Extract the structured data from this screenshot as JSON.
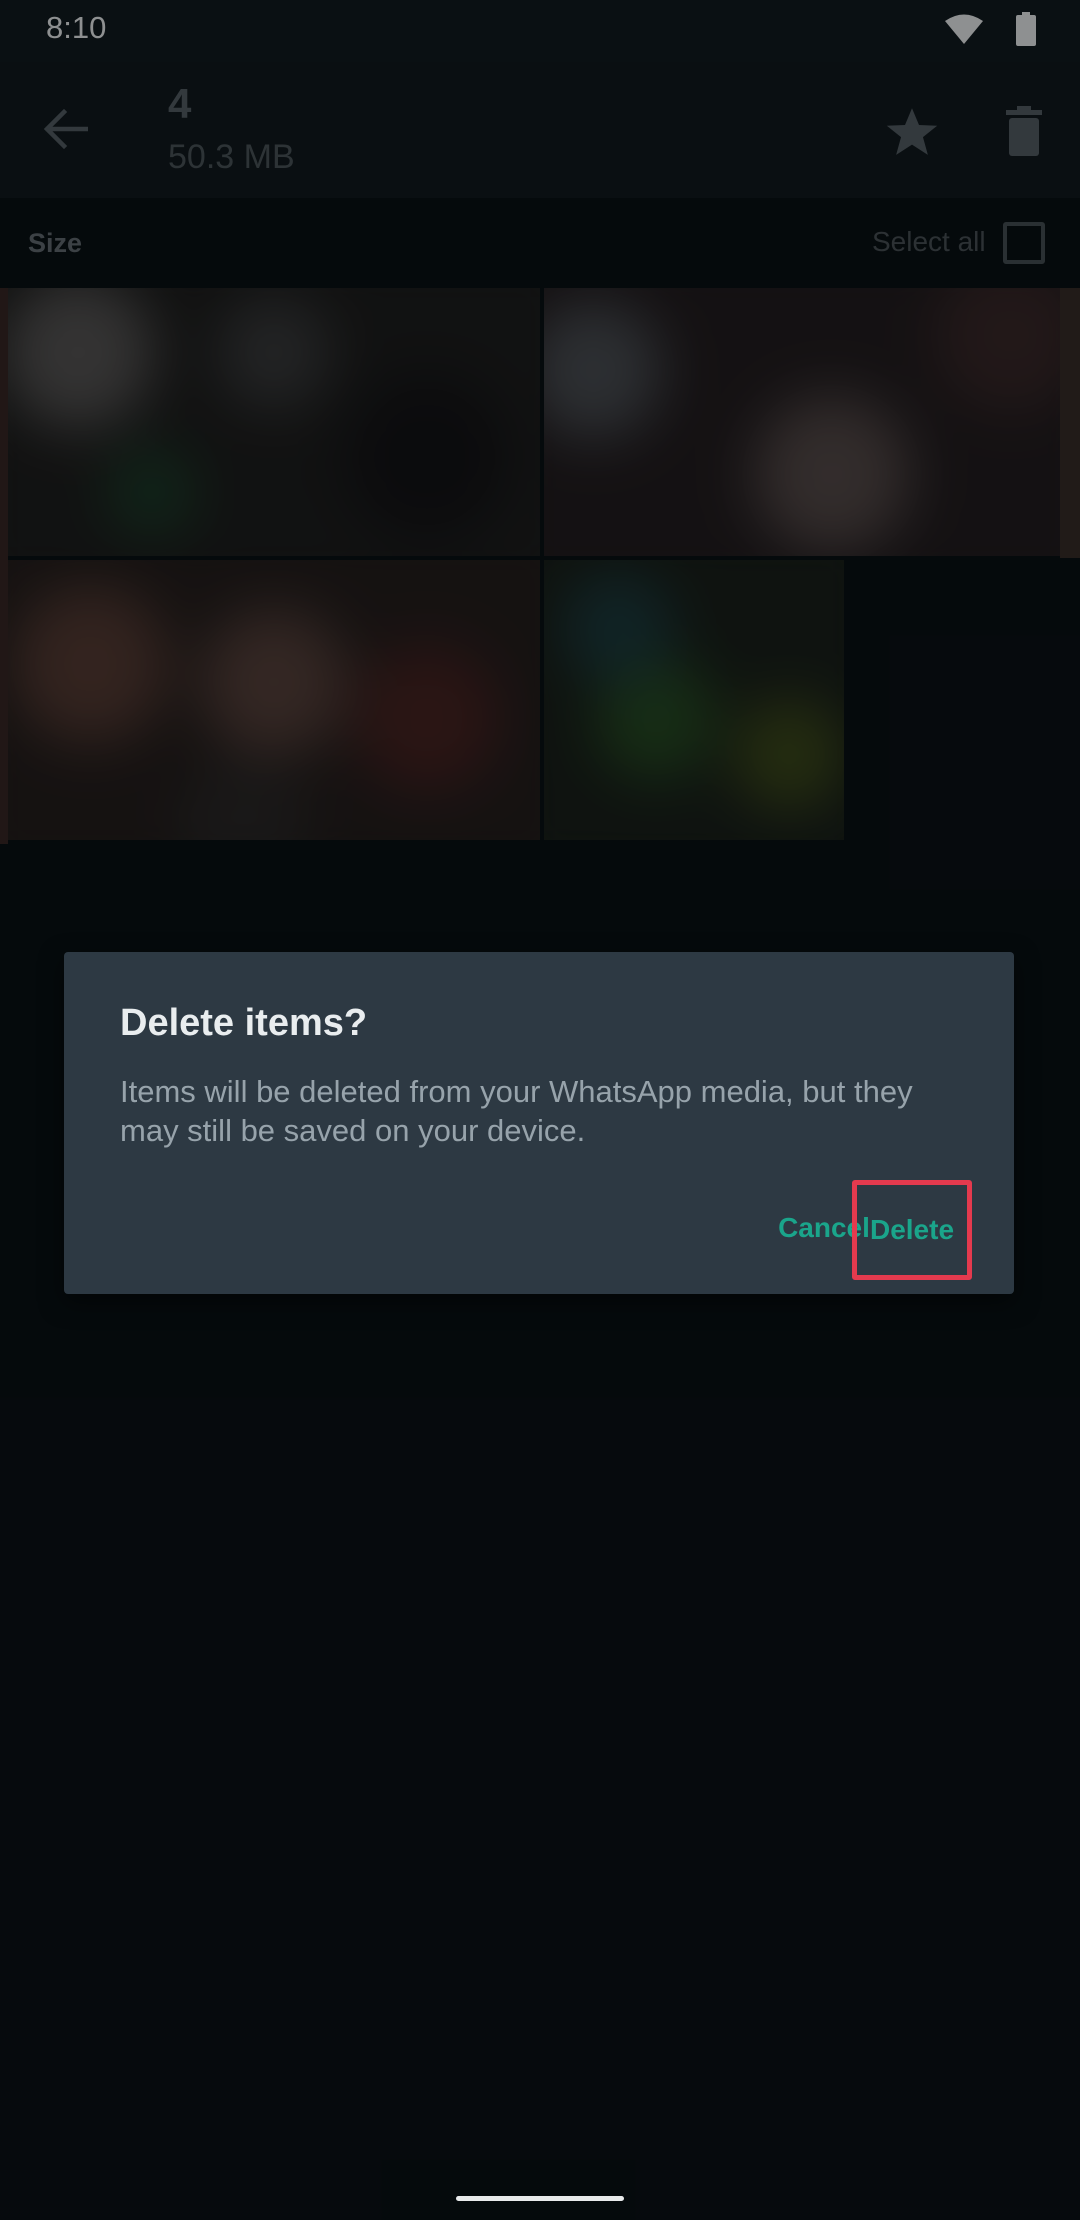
{
  "status_bar": {
    "time": "8:10",
    "icons": [
      "wifi-icon",
      "battery-icon"
    ]
  },
  "app_bar": {
    "back_icon": "back-arrow-icon",
    "count": "4",
    "size": "50.3 MB",
    "actions": [
      "star-icon",
      "trash-icon"
    ]
  },
  "section": {
    "sort_label": "Size",
    "select_all_label": "Select all"
  },
  "dialog": {
    "title": "Delete items?",
    "message": "Items will be deleted from your WhatsApp media, but they may still be saved on your device.",
    "cancel_label": "Cancel",
    "delete_label": "Delete"
  },
  "colors": {
    "accent": "#1aa58b",
    "highlight_border": "#e43a4e",
    "dialog_bg": "#2d3943",
    "background": "#070b0e"
  }
}
